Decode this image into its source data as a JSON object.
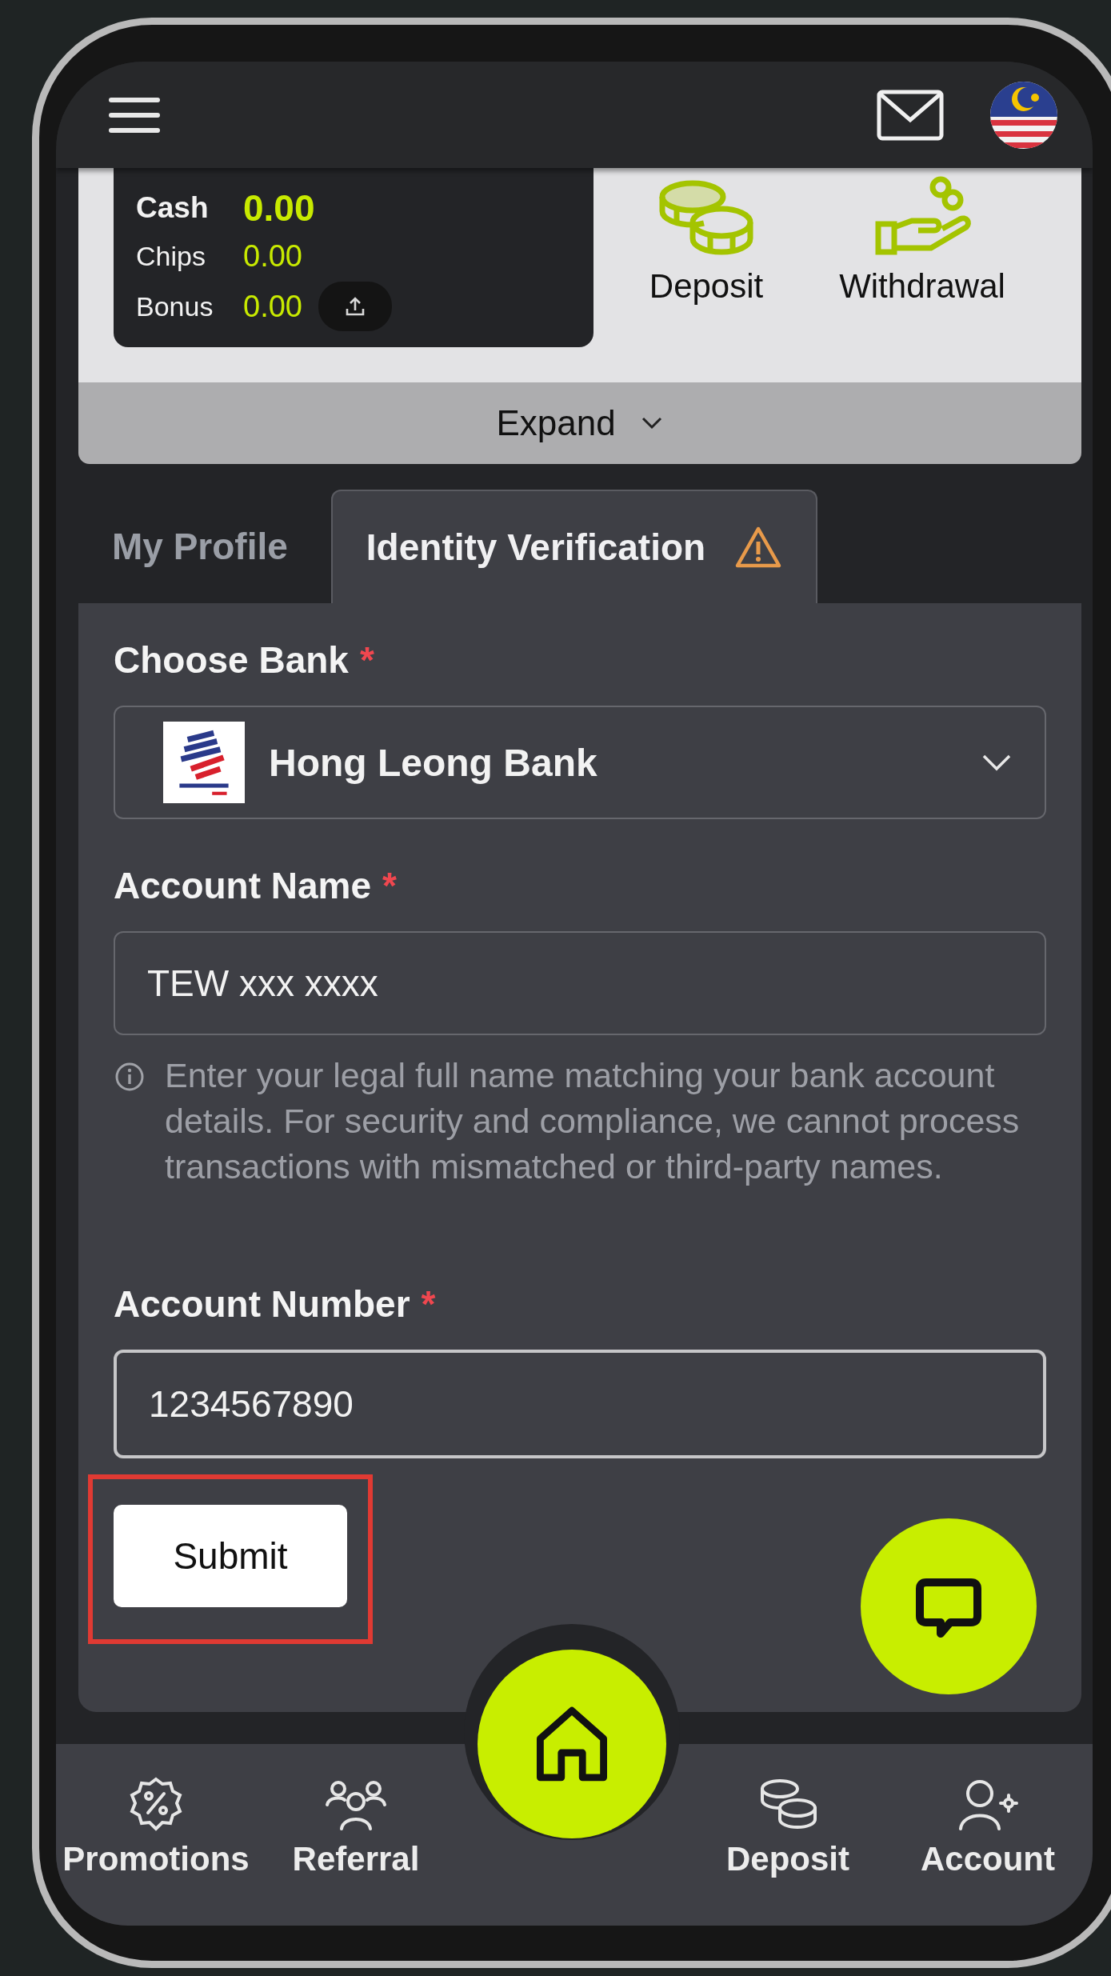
{
  "balance": {
    "rows": [
      {
        "label": "Cash",
        "value": "0.00",
        "emphasis": true
      },
      {
        "label": "Chips",
        "value": "0.00",
        "emphasis": false
      },
      {
        "label": "Bonus",
        "value": "0.00",
        "emphasis": false,
        "transfer": true
      }
    ]
  },
  "quick_actions": [
    {
      "kind": "deposit",
      "label": "Deposit"
    },
    {
      "kind": "withdrawal",
      "label": "Withdrawal"
    }
  ],
  "expand": {
    "label": "Expand"
  },
  "tabs": [
    {
      "label": "My Profile",
      "selected": false,
      "warning": false
    },
    {
      "label": "Identity Verification",
      "selected": true,
      "warning": true
    }
  ],
  "form": {
    "fields": [
      {
        "kind": "select",
        "label": "Choose Bank",
        "required_mark": "*",
        "value": "Hong Leong Bank"
      },
      {
        "kind": "text",
        "label": "Account Name",
        "required_mark": "*",
        "value": "TEW xxx xxxx",
        "focused": false,
        "hint": "Enter your legal full name matching your bank account details. For security and compliance, we cannot process transactions with mismatched or third-party names."
      },
      {
        "kind": "text",
        "label": "Account Number",
        "required_mark": "*",
        "value": "1234567890",
        "focused": true
      }
    ],
    "submit": "Submit",
    "submit_highlighted": true
  },
  "bottom_nav": [
    {
      "kind": "promotions",
      "label": "Promotions"
    },
    {
      "kind": "referral",
      "label": "Referral"
    },
    {
      "kind": "home"
    },
    {
      "kind": "deposit",
      "label": "Deposit"
    },
    {
      "kind": "account",
      "label": "Account"
    }
  ]
}
